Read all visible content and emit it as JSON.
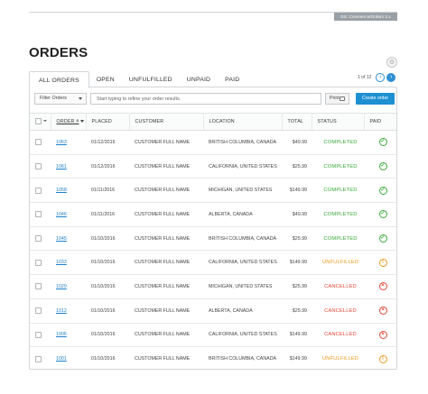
{
  "header": {
    "version_tag": "DX: Commerce/Orders 2.x"
  },
  "page": {
    "title": "ORDERS"
  },
  "tabs": [
    {
      "label": "ALL ORDERS",
      "active": true
    },
    {
      "label": "OPEN",
      "active": false
    },
    {
      "label": "UNFULFILLED",
      "active": false
    },
    {
      "label": "UNPAID",
      "active": false
    },
    {
      "label": "PAID",
      "active": false
    }
  ],
  "pager": {
    "label": "1 of 12",
    "prev_icon": "chevron-left-icon",
    "next_icon": "chevron-right-icon"
  },
  "toolbar": {
    "filter_value": "Filter Orders",
    "search_placeholder": "Start typing to refine your order results.",
    "print_label": "Print",
    "create_label": "Create order"
  },
  "table": {
    "columns": [
      "ORDER #",
      "PLACED",
      "CUSTOMER",
      "LOCATION",
      "TOTAL",
      "STATUS",
      "PAID"
    ],
    "rows": [
      {
        "order": "1063",
        "placed": "01/12/2016",
        "customer": "CUSTOMER FULL NAME",
        "location": "BRITISH COLUMBIA, CANADA",
        "total": "$49.99",
        "status": "COMPLETED",
        "paid": "check"
      },
      {
        "order": "1061",
        "placed": "01/12/2016",
        "customer": "CUSTOMER FULL NAME",
        "location": "CALIFORNIA, UNITED STATES",
        "total": "$25.99",
        "status": "COMPLETED",
        "paid": "check"
      },
      {
        "order": "1058",
        "placed": "01/11/2016",
        "customer": "CUSTOMER FULL NAME",
        "location": "MICHIGAN, UNITED STATES",
        "total": "$149.99",
        "status": "COMPLETED",
        "paid": "check"
      },
      {
        "order": "1046",
        "placed": "01/11/2016",
        "customer": "CUSTOMER FULL NAME",
        "location": "ALBERTA, CANADA",
        "total": "$49.99",
        "status": "COMPLETED",
        "paid": "check"
      },
      {
        "order": "1045",
        "placed": "01/10/2016",
        "customer": "CUSTOMER FULL NAME",
        "location": "BRITISH COLUMBIA, CANADA",
        "total": "$25.99",
        "status": "COMPLETED",
        "paid": "check"
      },
      {
        "order": "1033",
        "placed": "01/10/2016",
        "customer": "CUSTOMER FULL NAME",
        "location": "CALIFORNIA, UNITED STATES",
        "total": "$149.99",
        "status": "UNFULFILLED",
        "paid": "alert"
      },
      {
        "order": "1029",
        "placed": "01/10/2016",
        "customer": "CUSTOMER FULL NAME",
        "location": "MICHIGAN, UNITED STATES",
        "total": "$25.99",
        "status": "CANCELLED",
        "paid": "x"
      },
      {
        "order": "1012",
        "placed": "01/10/2016",
        "customer": "CUSTOMER FULL NAME",
        "location": "ALBERTA, CANADA",
        "total": "$25.99",
        "status": "CANCELLED",
        "paid": "x"
      },
      {
        "order": "1006",
        "placed": "01/10/2016",
        "customer": "CUSTOMER FULL NAME",
        "location": "CALIFORNIA, UNITED STATES",
        "total": "$149.99",
        "status": "CANCELLED",
        "paid": "x"
      },
      {
        "order": "1001",
        "placed": "01/10/2016",
        "customer": "CUSTOMER FULL NAME",
        "location": "BRITISH COLUMBIA, CANADA",
        "total": "$149.99",
        "status": "UNFULFILLED",
        "paid": "alert"
      }
    ]
  },
  "colors": {
    "accent": "#1e90d2",
    "completed": "#3aaa3a",
    "unfulfilled": "#f39a1e",
    "cancelled": "#e5483a"
  }
}
